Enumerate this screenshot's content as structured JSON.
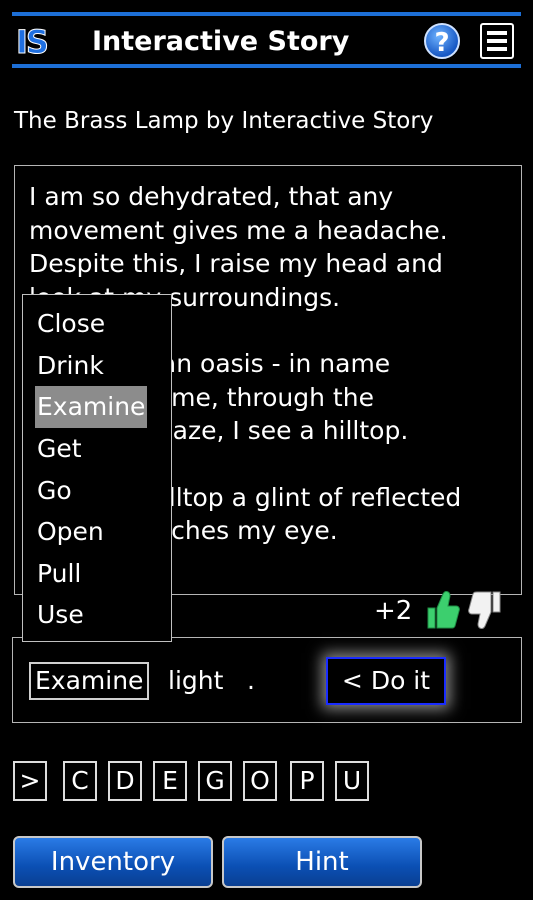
{
  "header": {
    "logo": "IS",
    "title": "Interactive Story",
    "help_label": "?"
  },
  "story": {
    "title": "The Brass Lamp by Interactive Story",
    "paragraphs": [
      [
        "I am so dehydrated, that any",
        "movement gives me a headache.",
        "Despite this, I raise my head and",
        "look at my surroundings."
      ],
      [
        "",
        "is an oasis - in name",
        "ve me, through the",
        "g haze, I see a hilltop."
      ],
      [
        "",
        "hilltop a glint of reflected",
        "atches my eye."
      ]
    ]
  },
  "rating": {
    "score": "+2"
  },
  "verb_menu": {
    "items": [
      "Close",
      "Drink",
      "Examine",
      "Get",
      "Go",
      "Open",
      "Pull",
      "Use"
    ],
    "selected": "Examine"
  },
  "command": {
    "verb": "Examine",
    "noun": "light",
    "terminator": ".",
    "doit_label": "< Do it"
  },
  "shortcuts": [
    ">",
    "C",
    "D",
    "E",
    "G",
    "O",
    "P",
    "U"
  ],
  "buttons": {
    "inventory": "Inventory",
    "hint": "Hint"
  },
  "colors": {
    "accent": "#1d6fd6",
    "button": "#0b4fb3",
    "selected_item": "#8c8c8c",
    "thumb_up": "#3ccf6e",
    "doit_border": "#1a2cff"
  }
}
